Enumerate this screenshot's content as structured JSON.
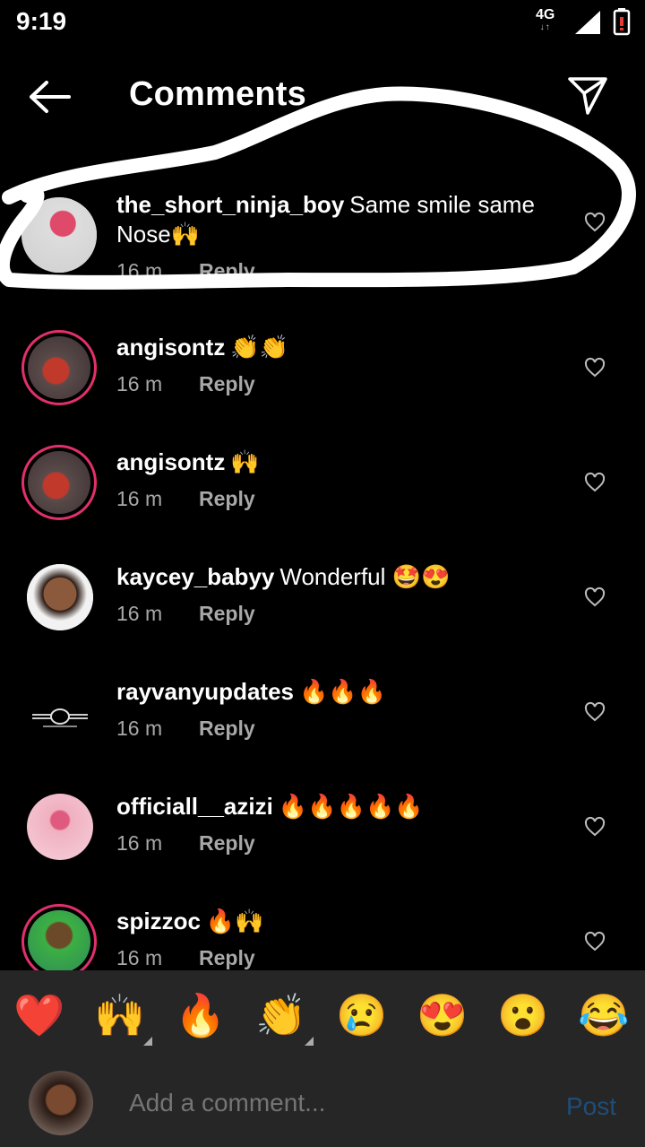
{
  "status": {
    "time": "9:19",
    "network": "4G"
  },
  "header": {
    "title": "Comments"
  },
  "comments": [
    {
      "user": "the_short_ninja_boy",
      "text": "Same smile same Nose🙌",
      "age": "16 m",
      "reply": "Reply"
    },
    {
      "user": "angisontz",
      "text": "👏👏",
      "age": "16 m",
      "reply": "Reply"
    },
    {
      "user": "angisontz",
      "text": "🙌",
      "age": "16 m",
      "reply": "Reply"
    },
    {
      "user": "kaycey_babyy",
      "text": "Wonderful 🤩😍",
      "age": "16 m",
      "reply": "Reply"
    },
    {
      "user": "rayvanyupdates",
      "text": "🔥🔥🔥",
      "age": "16 m",
      "reply": "Reply"
    },
    {
      "user": "officiall__azizi",
      "text": "🔥🔥🔥🔥🔥",
      "age": "16 m",
      "reply": "Reply"
    },
    {
      "user": "spizzoc",
      "text": "🔥🙌",
      "age": "16 m",
      "reply": "Reply"
    }
  ],
  "quick_reactions": [
    "❤️",
    "🙌",
    "🔥",
    "👏",
    "😢",
    "😍",
    "😮",
    "😂"
  ],
  "composer": {
    "placeholder": "Add a comment...",
    "post_label": "Post"
  },
  "colors": {
    "background": "#000000",
    "bar": "#262626",
    "post_disabled": "#1f4d7a",
    "story_ring": "#e1306c"
  }
}
